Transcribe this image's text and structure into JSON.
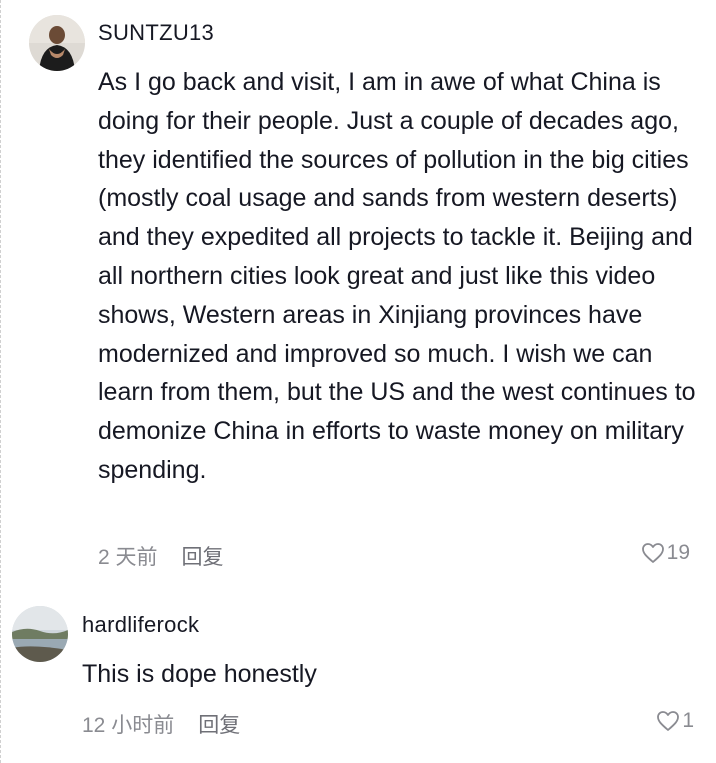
{
  "comments": [
    {
      "username": "SUNTZU13",
      "text": "As I go back and visit, I am in awe of what China is doing for their people. Just a couple of decades ago, they identified the sources of pollution in the big cities (mostly coal usage and sands from western deserts) and they expedited all projects to tackle it. Beijing and all northern cities look great and just like this video shows, Western areas in Xinjiang provinces have modernized and improved so much. I wish we can learn from them, but the US and the west continues to demonize China in efforts to waste money on military spending.",
      "time": "2 天前",
      "reply_label": "回复",
      "likes": "19",
      "icon": "heart-outline-icon"
    },
    {
      "username": "hardliferock",
      "text": "This is dope honestly",
      "time": "12 小时前",
      "reply_label": "回复",
      "likes": "1",
      "icon": "heart-outline-icon"
    }
  ],
  "colors": {
    "text": "#161823",
    "meta": "#8a8b91"
  }
}
